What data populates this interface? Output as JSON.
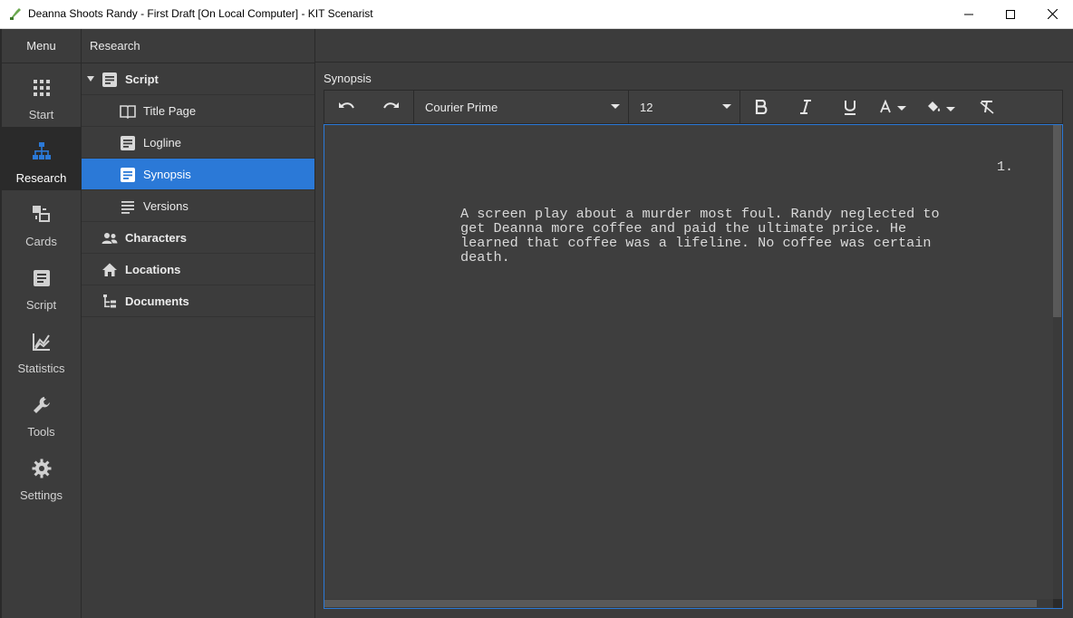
{
  "window": {
    "title": "Deanna Shoots Randy - First Draft [On Local Computer] - KIT Scenarist"
  },
  "nav": {
    "header": "Menu",
    "items": [
      {
        "label": "Start",
        "icon": "grid-icon"
      },
      {
        "label": "Research",
        "icon": "sitemap-icon",
        "active": true
      },
      {
        "label": "Cards",
        "icon": "cards-icon"
      },
      {
        "label": "Script",
        "icon": "document-icon"
      },
      {
        "label": "Statistics",
        "icon": "chart-icon"
      },
      {
        "label": "Tools",
        "icon": "wrench-icon"
      },
      {
        "label": "Settings",
        "icon": "gear-icon"
      }
    ]
  },
  "tree": {
    "header": "Research",
    "items": [
      {
        "label": "Script",
        "icon": "document-icon",
        "expanded": true
      },
      {
        "label": "Title Page",
        "icon": "book-icon"
      },
      {
        "label": "Logline",
        "icon": "document-icon"
      },
      {
        "label": "Synopsis",
        "icon": "document-icon",
        "active": true
      },
      {
        "label": "Versions",
        "icon": "lines-icon"
      },
      {
        "label": "Characters",
        "icon": "people-icon"
      },
      {
        "label": "Locations",
        "icon": "home-icon"
      },
      {
        "label": "Documents",
        "icon": "hierarchy-icon"
      }
    ]
  },
  "main": {
    "section_label": "Synopsis",
    "toolbar": {
      "font": "Courier Prime",
      "size": "12"
    },
    "page_number": "1.",
    "text": "A screen play about a murder most foul. Randy neglected to\nget Deanna more coffee and paid the ultimate price. He\nlearned that coffee was a lifeline. No coffee was certain\ndeath."
  },
  "colors": {
    "accent": "#2b79d7",
    "background": "#3c3c3c",
    "nav_active": "#2a2a2a"
  }
}
